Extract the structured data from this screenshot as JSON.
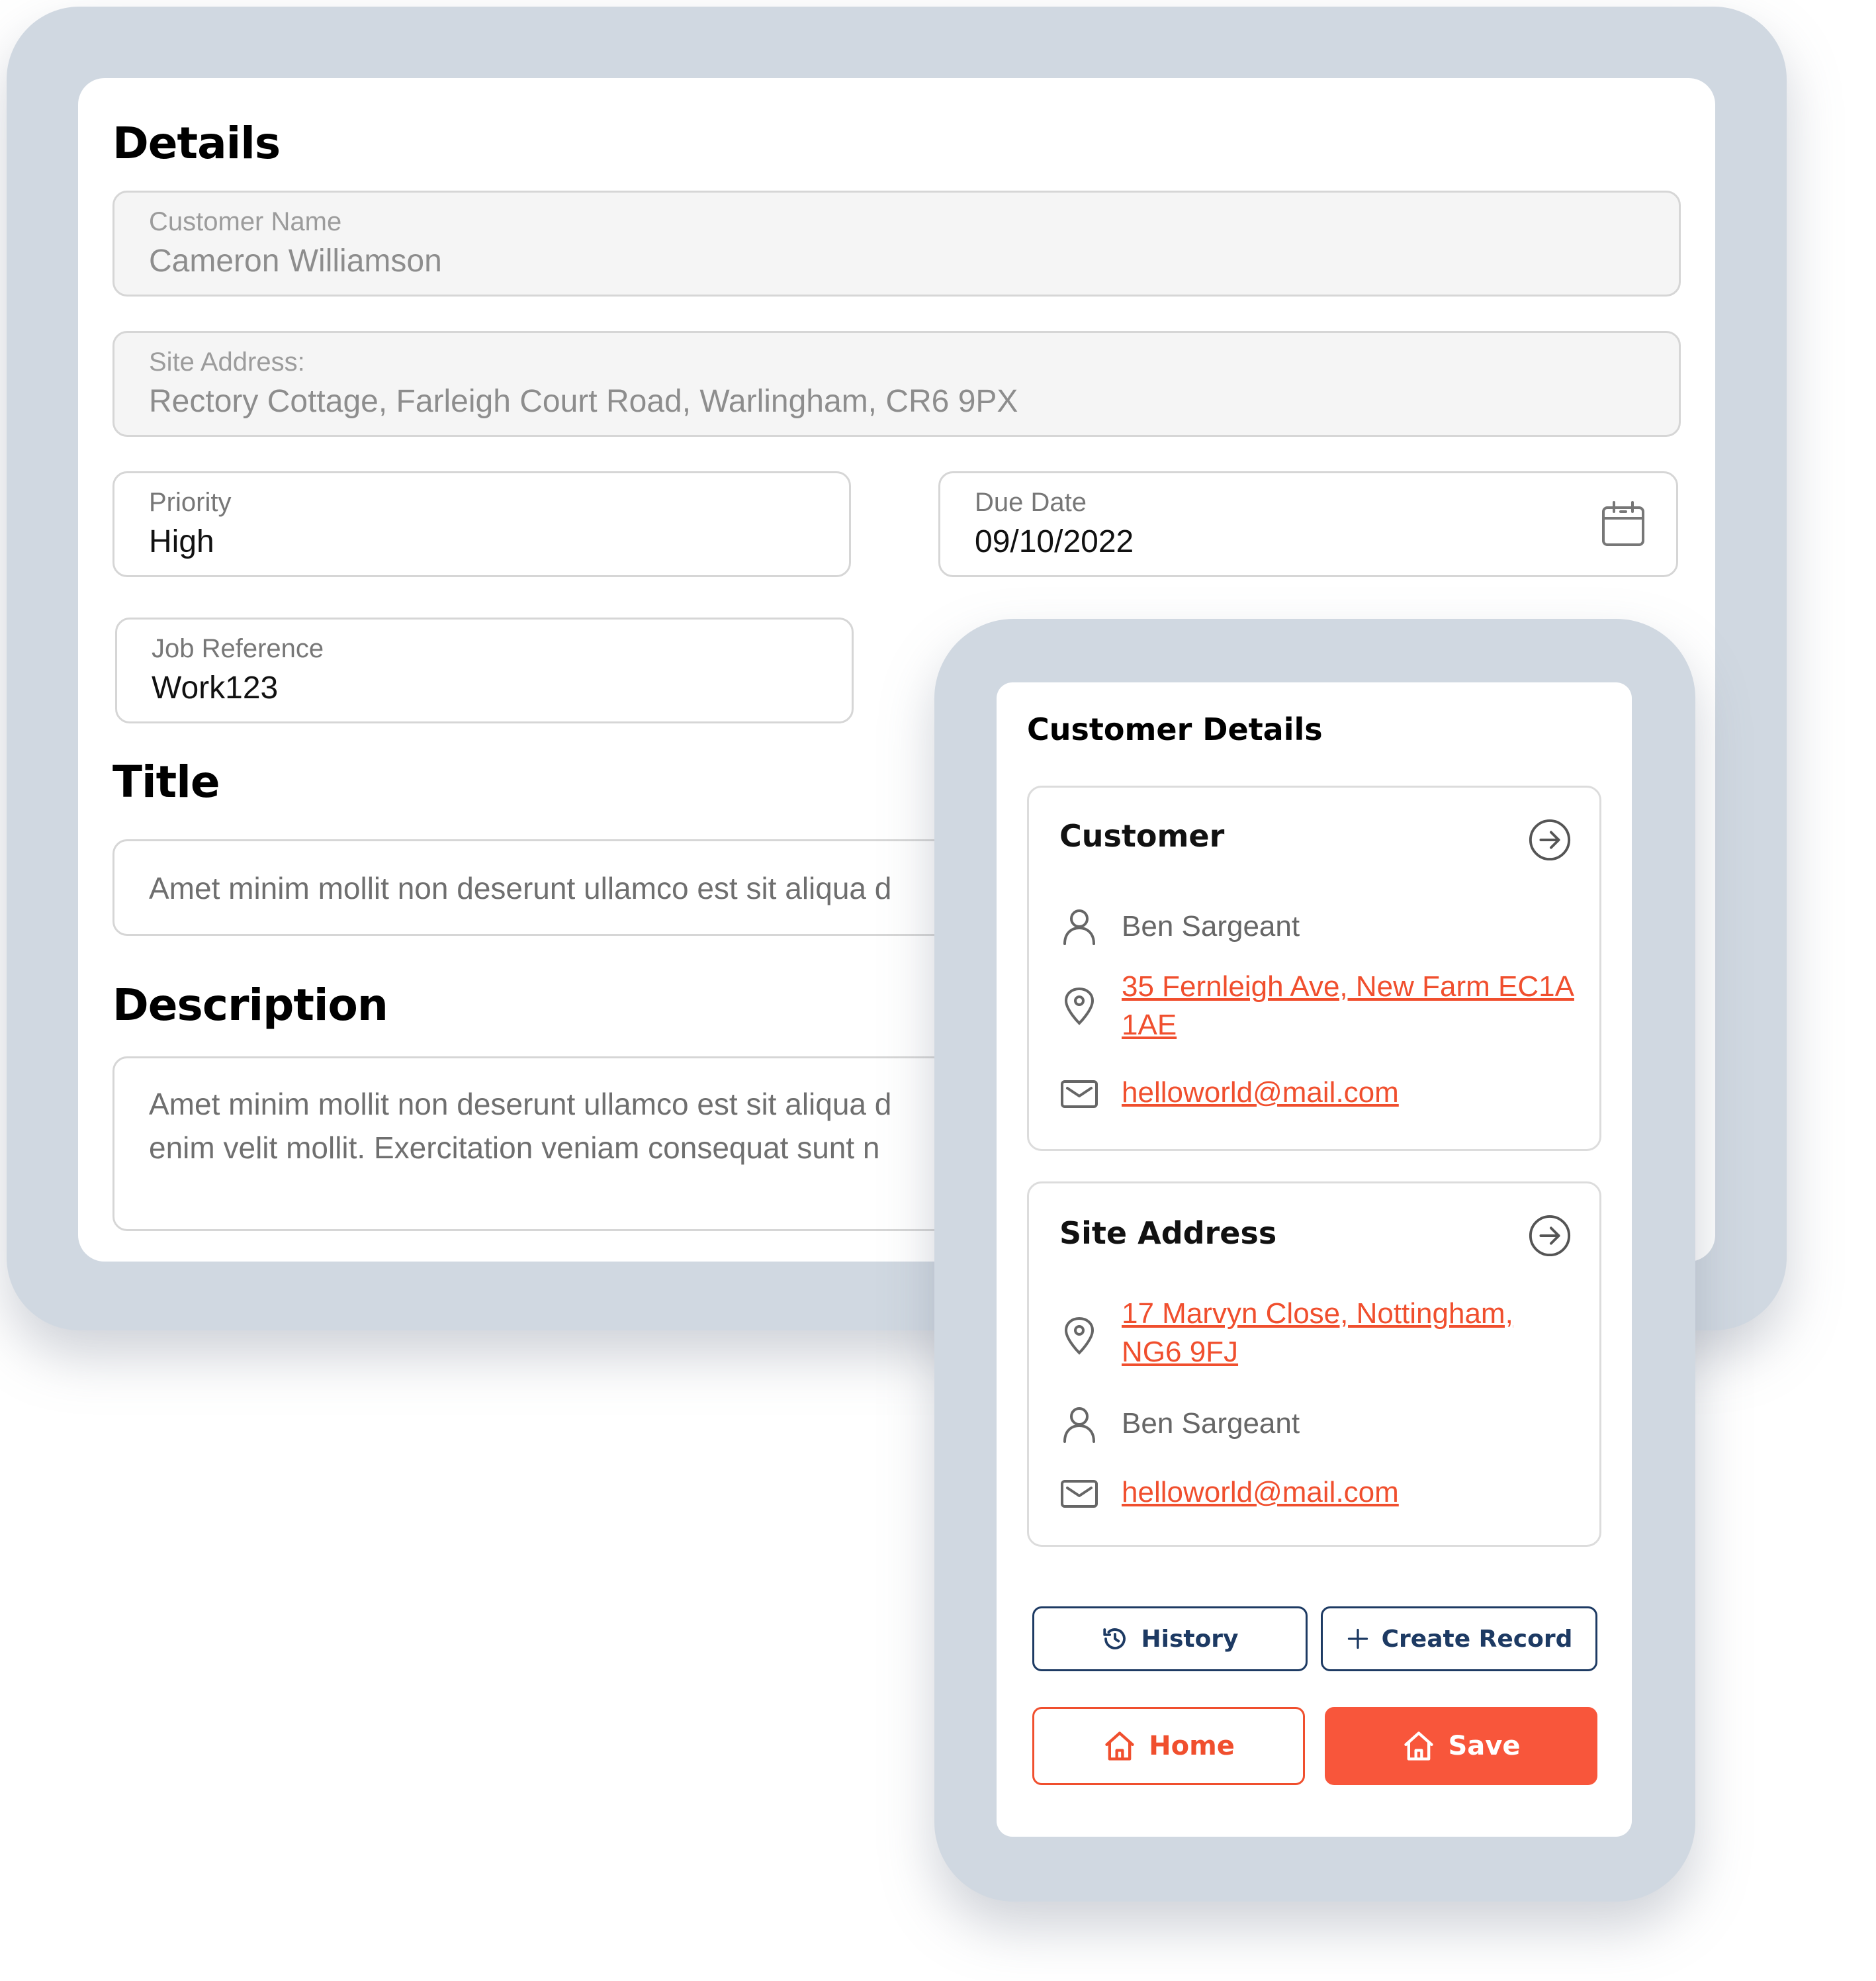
{
  "details": {
    "heading": "Details",
    "customer_name": {
      "label": "Customer Name",
      "value": "Cameron Williamson"
    },
    "site_address": {
      "label": "Site Address:",
      "value": "Rectory Cottage, Farleigh Court Road, Warlingham, CR6 9PX"
    },
    "priority": {
      "label": "Priority",
      "value": "High"
    },
    "due_date": {
      "label": "Due Date",
      "value": "09/10/2022"
    },
    "job_reference": {
      "label": "Job Reference",
      "value": "Work123"
    },
    "title_heading": "Title",
    "title_value": "Amet minim mollit non deserunt ullamco est sit aliqua d",
    "description_heading": "Description",
    "description_line1": "Amet minim mollit non deserunt ullamco est sit aliqua d",
    "description_line2": "enim velit mollit. Exercitation veniam consequat sunt n"
  },
  "customer_details": {
    "heading": "Customer Details",
    "customer_card": {
      "title": "Customer",
      "name": "Ben Sargeant",
      "address_line1": "35 Fernleigh Ave, New Farm EC1A",
      "address_line2": "1AE",
      "email": "helloworld@mail.com"
    },
    "site_card": {
      "title": "Site Address",
      "address_line1": "17 Marvyn Close, Nottingham,",
      "address_line2": "NG6 9FJ",
      "name": "Ben Sargeant",
      "email": "helloworld@mail.com"
    },
    "buttons": {
      "history": "History",
      "create_record": "Create Record",
      "home": "Home",
      "save": "Save"
    }
  },
  "colors": {
    "accent": "#f8563b",
    "navy": "#1d3a63",
    "frame": "#d0d8e1"
  },
  "icons": [
    "calendar-icon",
    "user-icon",
    "location-pin-icon",
    "mail-icon",
    "arrow-right-circle-icon",
    "history-icon",
    "plus-icon",
    "home-icon"
  ]
}
